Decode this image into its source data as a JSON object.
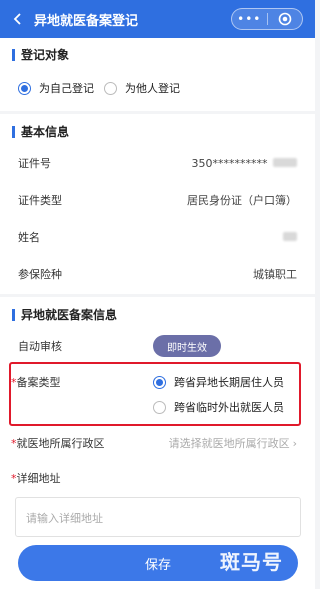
{
  "header": {
    "title": "异地就医备案登记",
    "more": "•••",
    "accent": "#2f6fe0"
  },
  "register_target": {
    "heading": "登记对象",
    "options": [
      {
        "label": "为自己登记",
        "selected": true
      },
      {
        "label": "为他人登记",
        "selected": false
      }
    ]
  },
  "basic_info": {
    "heading": "基本信息",
    "rows": [
      {
        "label": "证件号",
        "value": "350**********"
      },
      {
        "label": "证件类型",
        "value": "居民身份证（户口簿）"
      },
      {
        "label": "姓名",
        "value": ""
      },
      {
        "label": "参保险种",
        "value": "城镇职工"
      }
    ]
  },
  "record_info": {
    "heading": "异地就医备案信息",
    "auto_review_label": "自动审核",
    "auto_review_badge": "即时生效",
    "type_label": "备案类型",
    "type_options": [
      {
        "label": "跨省异地长期居住人员",
        "selected": true
      },
      {
        "label": "跨省临时外出就医人员",
        "selected": false
      }
    ],
    "region_label": "就医地所属行政区",
    "region_placeholder": "请选择就医地所属行政区",
    "address_label": "详细地址",
    "address_placeholder": "请输入详细地址"
  },
  "required_mark": "*",
  "save_label": "保存",
  "watermark": "斑马号"
}
